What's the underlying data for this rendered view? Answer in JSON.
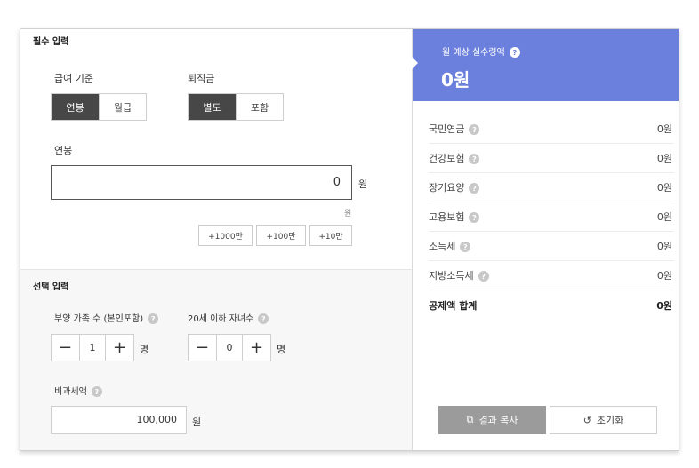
{
  "required": {
    "title": "필수 입력",
    "pay_basis": {
      "label": "급여 기준",
      "options": [
        "연봉",
        "월급"
      ],
      "selected": "연봉"
    },
    "severance": {
      "label": "퇴직금",
      "options": [
        "별도",
        "포함"
      ],
      "selected": "별도"
    },
    "salary": {
      "label": "연봉",
      "value": "0",
      "unit": "원",
      "sub_unit": "원"
    },
    "quick_buttons": [
      "+1000만",
      "+100만",
      "+10만"
    ]
  },
  "optional": {
    "title": "선택 입력",
    "dependents": {
      "label": "부양 가족 수 (본인포함)",
      "value": "1",
      "unit": "명"
    },
    "children": {
      "label": "20세 이하 자녀수",
      "value": "0",
      "unit": "명"
    },
    "nontax": {
      "label": "비과세액",
      "value": "100,000",
      "unit": "원"
    }
  },
  "icons": {
    "minus": "−",
    "plus": "+",
    "help": "?",
    "copy": "⧉",
    "reset": "↺"
  },
  "result": {
    "title": "월 예상 실수령액",
    "value": "0원",
    "accent_color": "#6b7fdd",
    "rows": [
      {
        "label": "국민연금",
        "value": "0원"
      },
      {
        "label": "건강보험",
        "value": "0원"
      },
      {
        "label": "장기요양",
        "value": "0원"
      },
      {
        "label": "고용보험",
        "value": "0원"
      },
      {
        "label": "소득세",
        "value": "0원"
      },
      {
        "label": "지방소득세",
        "value": "0원"
      }
    ],
    "total": {
      "label": "공제액 합계",
      "value": "0원"
    },
    "copy_label": "결과 복사",
    "reset_label": "초기화"
  }
}
